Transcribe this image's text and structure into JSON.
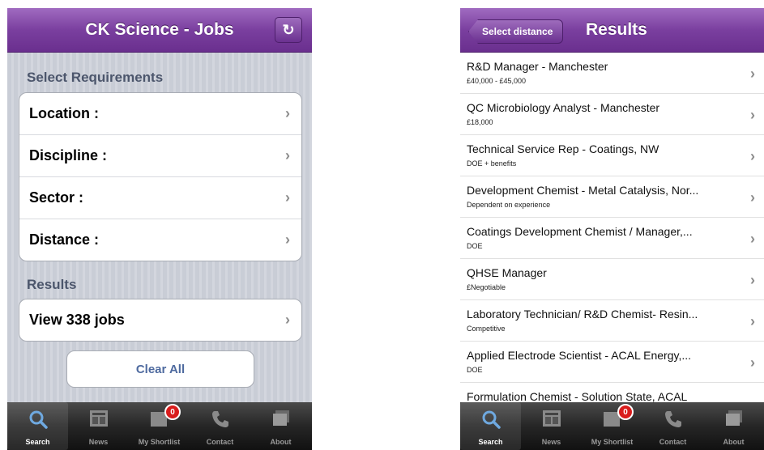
{
  "left_screen": {
    "title": "CK Science - Jobs",
    "refresh_icon": "refresh-icon",
    "requirements_header": "Select Requirements",
    "requirements": [
      {
        "label": "Location :"
      },
      {
        "label": "Discipline :"
      },
      {
        "label": "Sector :"
      },
      {
        "label": "Distance :"
      }
    ],
    "results_header": "Results",
    "view_jobs": "View 338 jobs",
    "clear_all": "Clear All"
  },
  "right_screen": {
    "back_label": "Select distance",
    "title": "Results",
    "jobs": [
      {
        "title": "R&D Manager - Manchester",
        "salary": "£40,000 - £45,000"
      },
      {
        "title": "QC Microbiology Analyst - Manchester",
        "salary": "£18,000"
      },
      {
        "title": "Technical Service Rep - Coatings, NW",
        "salary": "DOE + benefits"
      },
      {
        "title": "Development Chemist - Metal Catalysis, Nor...",
        "salary": "Dependent on experience"
      },
      {
        "title": "Coatings Development Chemist / Manager,...",
        "salary": "DOE"
      },
      {
        "title": "QHSE Manager",
        "salary": "£Negotiable"
      },
      {
        "title": "Laboratory Technician/ R&D Chemist- Resin...",
        "salary": "Competitive"
      },
      {
        "title": "Applied Electrode Scientist - ACAL Energy,...",
        "salary": "DOE"
      },
      {
        "title": "Formulation Chemist - Solution State, ACAL",
        "salary": ""
      }
    ]
  },
  "tabbar": {
    "tabs": [
      {
        "label": "Search",
        "icon": "search-icon"
      },
      {
        "label": "News",
        "icon": "news-icon"
      },
      {
        "label": "My Shortlist",
        "icon": "shortlist-icon"
      },
      {
        "label": "Contact",
        "icon": "phone-icon"
      },
      {
        "label": "About",
        "icon": "about-icon"
      }
    ],
    "shortlist_badge": "0"
  },
  "colors": {
    "navbar": "#7a3f9f",
    "tabbar": "#262626",
    "badge": "#d91c1c",
    "clear_text": "#4e6a9f"
  }
}
